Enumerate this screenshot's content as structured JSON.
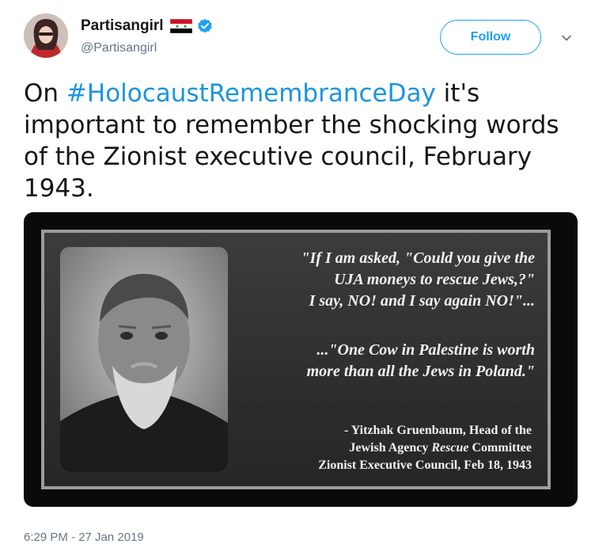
{
  "user": {
    "display_name": "Partisangirl",
    "handle": "@Partisangirl",
    "flag_icon": "syria-flag-icon",
    "verified_icon": "verified-badge-icon",
    "verified_color": "#1da1f2"
  },
  "actions": {
    "follow_label": "Follow",
    "menu_icon": "chevron-down-icon"
  },
  "tweet": {
    "text_before": "On ",
    "hashtag": "#HolocaustRemembranceDay",
    "text_after": " it's important to remember the shocking words of the Zionist executive council, February 1943.",
    "hashtag_color": "#1b95e0"
  },
  "media": {
    "quote_lines": [
      "\"If I am asked, \"Could you give the",
      "UJA moneys to rescue Jews,?\"",
      "I say, NO! and I say again NO!\"...",
      "...\"One Cow in Palestine is worth",
      "more than all the Jews in Poland.\""
    ],
    "attribution": {
      "line1": "- Yitzhak Gruenbaum, Head of the",
      "line2_pre": "Jewish Agency ",
      "line2_italic": "Rescue",
      "line2_post": " Committee",
      "line3": "Zionist Executive Council, Feb 18, 1943"
    }
  },
  "timestamp": "6:29 PM - 27 Jan 2019"
}
